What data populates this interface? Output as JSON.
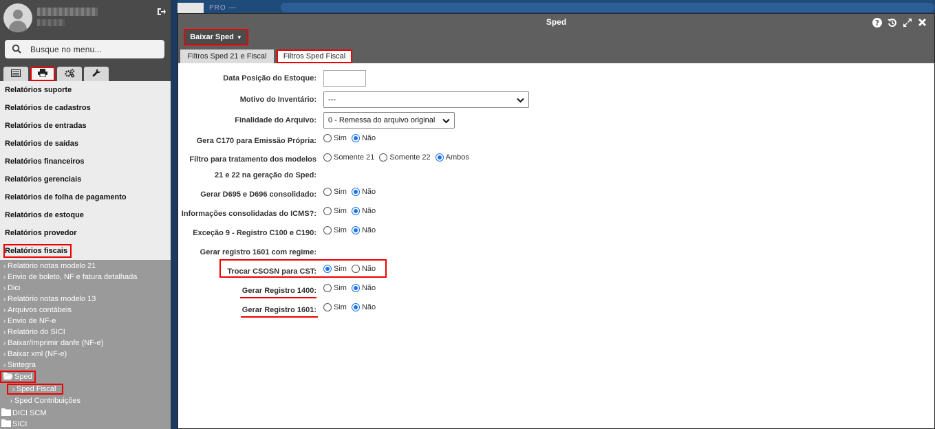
{
  "sidebar": {
    "search_placeholder": "Busque no menu...",
    "menu": [
      "Relatórios suporte",
      "Relatórios de cadastros",
      "Relatórios de entradas",
      "Relatórios de saídas",
      "Relatórios financeiros",
      "Relatórios gerenciais",
      "Relatórios de folha de pagamento",
      "Relatórios de estoque",
      "Relatórios provedor",
      "Relatórios fiscais"
    ],
    "sub": [
      "Relatório notas modelo 21",
      "Envio de boleto, NF e fatura detalhada",
      "Dici",
      "Relatório notas modelo 13",
      "Arquivos contábeis",
      "Envio de NF-e",
      "Relatório do SICI",
      "Baixar/Imprimir danfe (NF-e)",
      "Baixar xml (NF-e)",
      "Sintegra"
    ],
    "sped": "Sped",
    "sped_fiscal": "Sped Fiscal",
    "sped_contrib": "Sped Contribuições",
    "dici_scm": "DICI SCM",
    "sici": "SICI"
  },
  "bg": {
    "text": "PRO —"
  },
  "window": {
    "title": "Sped",
    "download_button": "Baixar Sped",
    "tabs": [
      "Filtros Sped 21 e Fiscal",
      "Filtros Sped Fiscal"
    ]
  },
  "form": {
    "data_posicao": "Data Posição do Estoque:",
    "motivo": "Motivo do Inventário:",
    "motivo_value": "---",
    "finalidade": "Finalidade do Arquivo:",
    "finalidade_value": "0 - Remessa do arquivo original",
    "gera_c170": "Gera C170 para Emissão Própria:",
    "filtro_l1": "Filtro para tratamento dos modelos",
    "filtro_l2": "21 e 22 na geração do Sped:",
    "gerar_d695": "Gerar D695 e D696 consolidado:",
    "info_icms": "Informações consolidadas do ICMS?:",
    "excecao9": "Exceção 9 - Registro C100 e C190:",
    "gerar_1601_regime": "Gerar registro 1601 com regime:",
    "trocar_csosn": "Trocar CSOSN para CST:",
    "gerar_1400": "Gerar Registro 1400:",
    "gerar_1601": "Gerar Registro 1601:",
    "sim": "Sim",
    "nao": "Não",
    "somente21": "Somente 21",
    "somente22": "Somente 22",
    "ambos": "Ambos"
  }
}
